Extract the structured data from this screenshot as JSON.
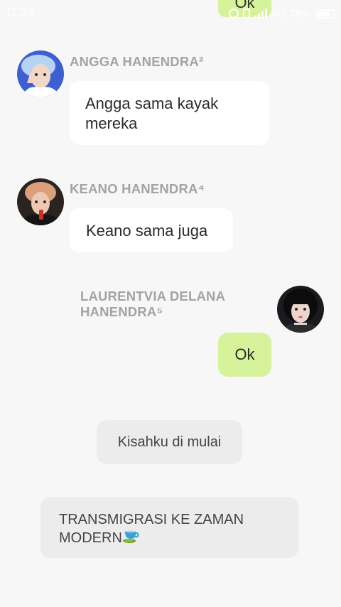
{
  "status_bar": {
    "time": "11.33",
    "network": "4G",
    "signal_sub": "4G",
    "battery": "78%",
    "peek_text": "Ok"
  },
  "messages": [
    {
      "sender": "ANGGA HANENDRA²",
      "text": "Angga sama kayak mereka",
      "line1": "Angga sama kayak",
      "line2": "mereka"
    },
    {
      "sender": "KEANO HANENDRA⁴",
      "text": "Keano sama juga"
    },
    {
      "sender_line1": "LAURENTVIA DELANA",
      "sender_line2": "HANENDRA⁵",
      "text": "Ok"
    }
  ],
  "system_notes": [
    {
      "text": "Kisahku di mulai"
    },
    {
      "line1": "TRANSMIGRASI KE ZAMAN",
      "line2": "MODERN",
      "emoji": "teacup-icon"
    }
  ],
  "colors": {
    "background": "#f7f7f7",
    "bubble_other": "#ffffff",
    "bubble_me": "#d6f29a",
    "system_bubble": "#ececec",
    "name_gray": "#a3a3a3"
  }
}
